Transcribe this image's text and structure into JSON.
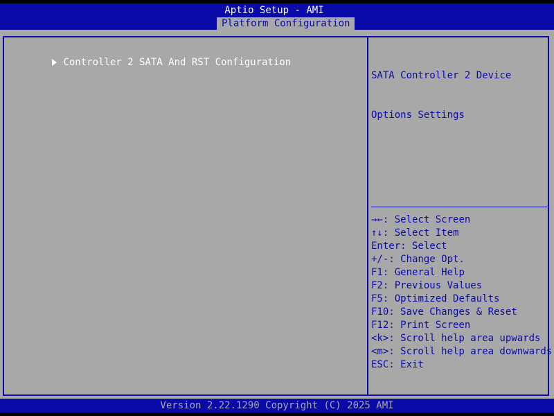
{
  "header": {
    "title": "Aptio Setup - AMI",
    "active_tab": "Platform Configuration"
  },
  "menu": {
    "items": [
      {
        "label": "Controller 2 SATA And RST Configuration",
        "icon": "submenu-arrow-icon"
      }
    ]
  },
  "help": {
    "lines": [
      "SATA Controller 2 Device",
      "Options Settings"
    ]
  },
  "keys": [
    {
      "key": "→←:",
      "action": " Select Screen"
    },
    {
      "key": "↑↓:",
      "action": " Select Item"
    },
    {
      "key": "Enter:",
      "action": " Select"
    },
    {
      "key": "+/-:",
      "action": " Change Opt."
    },
    {
      "key": "F1:",
      "action": " General Help"
    },
    {
      "key": "F2:",
      "action": " Previous Values"
    },
    {
      "key": "F5:",
      "action": " Optimized Defaults"
    },
    {
      "key": "F10:",
      "action": " Save Changes & Reset"
    },
    {
      "key": "F12:",
      "action": " Print Screen"
    },
    {
      "key": "<k>:",
      "action": " Scroll help area upwards"
    },
    {
      "key": "<m>:",
      "action": " Scroll help area downwards"
    },
    {
      "key": "ESC:",
      "action": " Exit"
    }
  ],
  "footer": {
    "version": "Version 2.22.1290 Copyright (C) 2025 AMI"
  },
  "colors": {
    "bios_blue": "#0A0AA8",
    "bios_gray": "#A8A8A8",
    "highlight_text": "#FFFFFF"
  }
}
